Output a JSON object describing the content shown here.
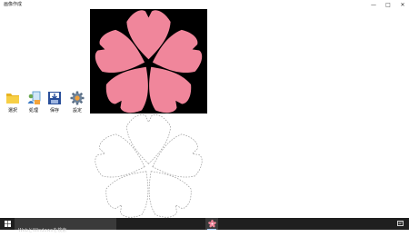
{
  "app": {
    "title": "画像作成",
    "window_controls": {
      "minimize": "—",
      "maximize": "□",
      "close": "✕"
    }
  },
  "toolbar": [
    {
      "label": "選択",
      "icon": "folder-icon"
    },
    {
      "label": "処理",
      "icon": "process-icon"
    },
    {
      "label": "保存",
      "icon": "save-icon"
    },
    {
      "label": "設定",
      "icon": "gear-icon"
    }
  ],
  "preview": {
    "background": "#000000",
    "flower_color": "#f0869b",
    "flower": "sakura-blossom"
  },
  "outline": {
    "stroke_color": "#999999",
    "style": "dashed"
  },
  "taskbar": {
    "search_placeholder": "WebとWindowsを検索",
    "start_icon": "windows-logo-icon",
    "app_icon": "sakura-app-icon",
    "tray_icon": "notification-icon",
    "background": "#1f1f1f"
  }
}
